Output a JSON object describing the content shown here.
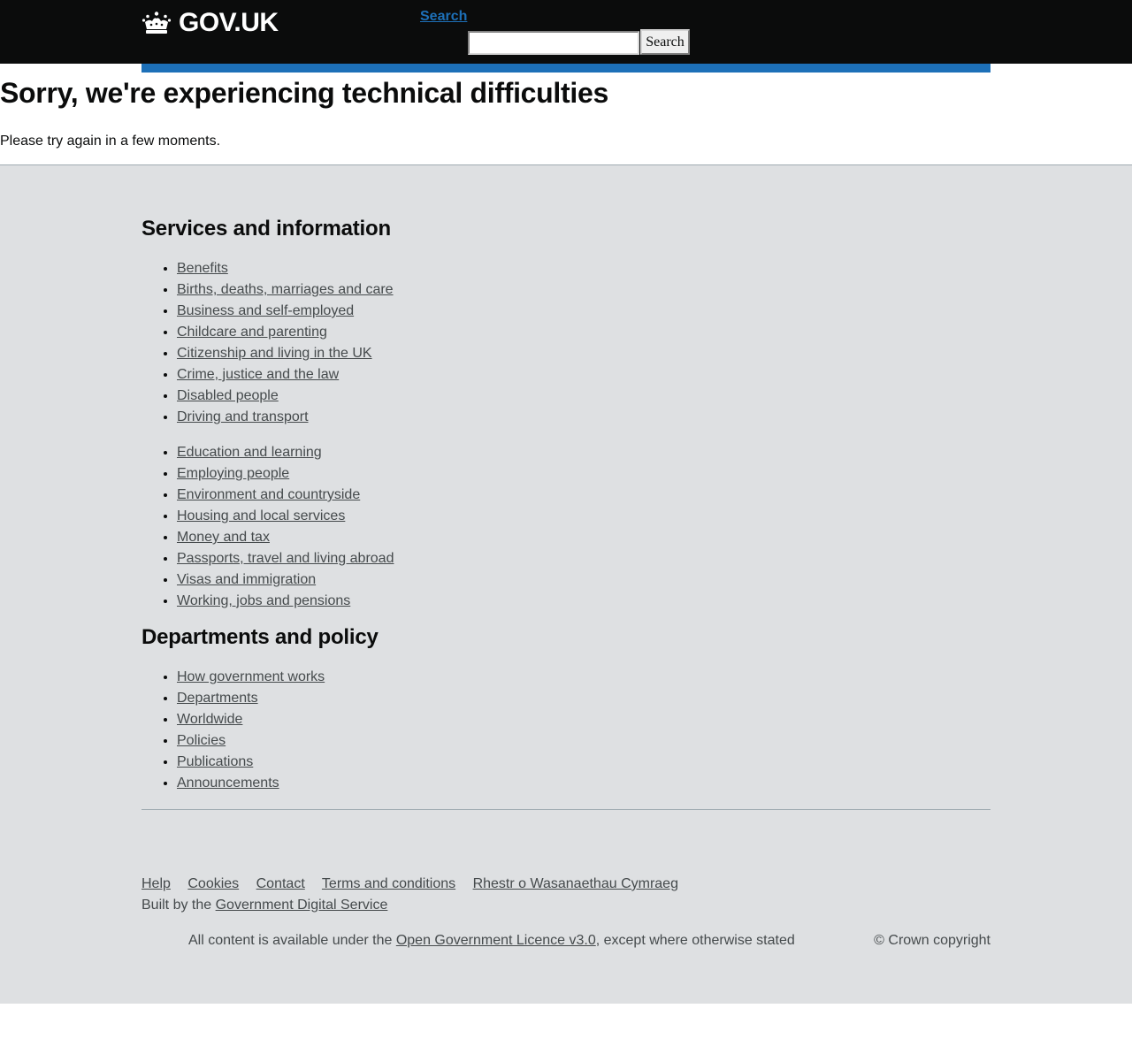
{
  "header": {
    "logo_text": "GOV.UK",
    "logo_icon": "crown-icon",
    "search_link": "Search",
    "search_input_value": "",
    "search_button": "Search"
  },
  "main": {
    "title": "Sorry, we're experiencing technical difficulties",
    "message": "Please try again in a few moments."
  },
  "footer": {
    "services_heading": "Services and information",
    "services_col1": [
      "Benefits",
      "Births, deaths, marriages and care",
      "Business and self-employed",
      "Childcare and parenting",
      "Citizenship and living in the UK",
      "Crime, justice and the law",
      "Disabled people",
      "Driving and transport"
    ],
    "services_col2": [
      "Education and learning",
      "Employing people",
      "Environment and countryside",
      "Housing and local services",
      "Money and tax",
      "Passports, travel and living abroad",
      "Visas and immigration",
      "Working, jobs and pensions"
    ],
    "departments_heading": "Departments and policy",
    "departments": [
      "How government works",
      "Departments",
      "Worldwide",
      "Policies",
      "Publications",
      "Announcements"
    ],
    "meta_links": [
      "Help",
      "Cookies",
      "Contact",
      "Terms and conditions",
      "Rhestr o Wasanaethau Cymraeg"
    ],
    "built_by_prefix": "Built by the",
    "built_by_link": "Government Digital Service",
    "licence_prefix": "All content is available under the",
    "licence_link": "Open Government Licence v3.0",
    "licence_suffix": ", except where otherwise stated",
    "copyright": "© Crown copyright"
  },
  "colors": {
    "header_bg": "#0b0c0c",
    "brand_blue": "#1d70b8",
    "footer_bg": "#dee0e2",
    "footer_link": "#454a4c"
  }
}
